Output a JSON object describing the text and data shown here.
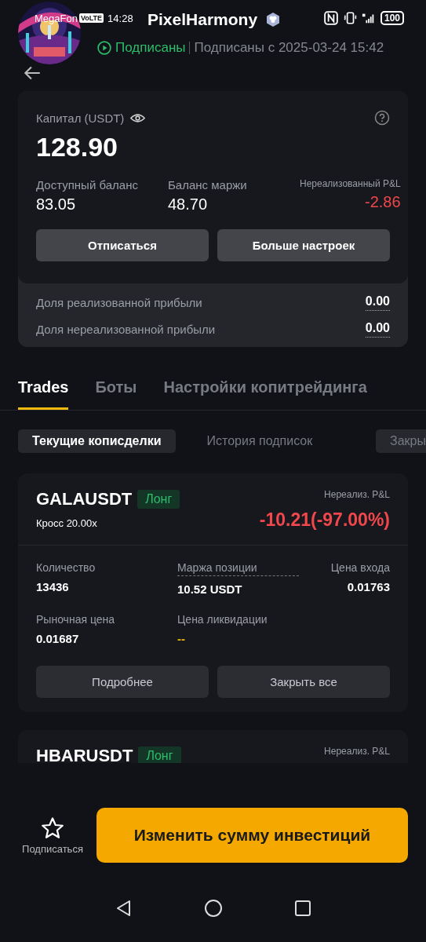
{
  "status_bar": {
    "carrier": "MegaFon",
    "network_badge": "VoLTE",
    "time": "14:28",
    "battery": "100"
  },
  "header": {
    "title": "PixelHarmony",
    "status": "Подписаны",
    "subscribed_since": "Подписаны с 2025-03-24 15:42"
  },
  "capital": {
    "label": "Капитал (USDT)",
    "value": "128.90",
    "stats": [
      {
        "label": "Доступный баланс",
        "value": "83.05",
        "kind": "plain"
      },
      {
        "label": "Баланс маржи",
        "value": "48.70",
        "kind": "plain"
      },
      {
        "label": "Нереализованный P&L",
        "value": "-2.86",
        "kind": "loss"
      }
    ],
    "buttons": [
      "Отписаться",
      "Больше настроек"
    ],
    "profit_shares": [
      {
        "label": "Доля реализованной прибыли",
        "value": "0.00"
      },
      {
        "label": "Доля нереализованной прибыли",
        "value": "0.00"
      }
    ]
  },
  "tabs": [
    {
      "label": "Trades",
      "selected": true
    },
    {
      "label": "Боты",
      "selected": false
    },
    {
      "label": "Настройки копитрейдинга",
      "selected": false
    }
  ],
  "subtabs": [
    {
      "label": "Текущие кописделки",
      "selected": true
    },
    {
      "label": "История подписок",
      "selected": false
    },
    {
      "label": "Закры",
      "selected": false
    }
  ],
  "positions": [
    {
      "symbol": "GALAUSDT",
      "side": "Лонг",
      "margin_mode": "Кросс 20.00x",
      "pnl_label": "Нереализ. P&L",
      "pnl": "-10.21(-97.00%)",
      "fields": [
        {
          "label": "Количество",
          "value": "13436",
          "underlined": false,
          "kind": "plain"
        },
        {
          "label": "Маржа позиции",
          "value": "10.52 USDT",
          "underlined": true,
          "kind": "plain"
        },
        {
          "label": "Цена входа",
          "value": "0.01763",
          "underlined": false,
          "kind": "plain"
        },
        {
          "label": "Рыночная цена",
          "value": "0.01687",
          "underlined": false,
          "kind": "plain"
        },
        {
          "label": "Цена ликвидации",
          "value": "--",
          "underlined": false,
          "kind": "pending"
        }
      ],
      "buttons": [
        "Подробнее",
        "Закрыть все"
      ]
    },
    {
      "symbol": "HBARUSDT",
      "side": "Лонг",
      "pnl_label": "Нереализ. P&L"
    }
  ],
  "footer": {
    "subscribe_label": "Подписаться",
    "primary_button": "Изменить сумму инвестиций"
  }
}
